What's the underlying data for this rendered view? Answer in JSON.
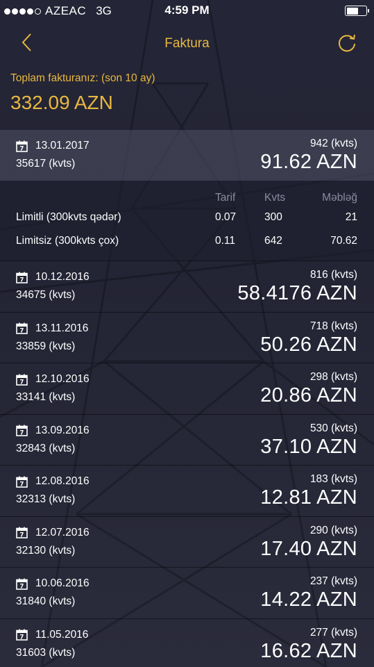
{
  "status_bar": {
    "carrier": "AZEAC",
    "network": "3G",
    "time": "4:59 PM",
    "battery_level": 0.62
  },
  "nav": {
    "title": "Faktura",
    "back_icon": "chevron-left-icon",
    "refresh_icon": "refresh-icon"
  },
  "total": {
    "label": "Toplam fakturanız: (son 10 ay)",
    "value": "332.09 AZN"
  },
  "first_invoice": {
    "date": "13.01.2017",
    "reading": "35617 (kvts)",
    "kvts": "942 (kvts)",
    "amount": "91.62 AZN"
  },
  "detail": {
    "headers": {
      "tarif": "Tarif",
      "kvts": "Kvts",
      "mebleg": "Məbləğ"
    },
    "rows": [
      {
        "name": "Limitli (300kvts qədər)",
        "tarif": "0.07",
        "kvts": "300",
        "mebleg": "21"
      },
      {
        "name": "Limitsiz (300kvts çox)",
        "tarif": "0.11",
        "kvts": "642",
        "mebleg": "70.62"
      }
    ]
  },
  "invoices": [
    {
      "date": "10.12.2016",
      "reading": "34675 (kvts)",
      "kvts": "816 (kvts)",
      "amount": "58.4176 AZN"
    },
    {
      "date": "13.11.2016",
      "reading": "33859 (kvts)",
      "kvts": "718 (kvts)",
      "amount": "50.26 AZN"
    },
    {
      "date": "12.10.2016",
      "reading": "33141 (kvts)",
      "kvts": "298 (kvts)",
      "amount": "20.86 AZN"
    },
    {
      "date": "13.09.2016",
      "reading": "32843 (kvts)",
      "kvts": "530 (kvts)",
      "amount": "37.10 AZN"
    },
    {
      "date": "12.08.2016",
      "reading": "32313 (kvts)",
      "kvts": "183 (kvts)",
      "amount": "12.81 AZN"
    },
    {
      "date": "12.07.2016",
      "reading": "32130 (kvts)",
      "kvts": "290 (kvts)",
      "amount": "17.40 AZN"
    },
    {
      "date": "10.06.2016",
      "reading": "31840 (kvts)",
      "kvts": "237 (kvts)",
      "amount": "14.22 AZN"
    },
    {
      "date": "11.05.2016",
      "reading": "31603 (kvts)",
      "kvts": "277 (kvts)",
      "amount": "16.62 AZN"
    }
  ],
  "calendar_icon_day": "7",
  "colors": {
    "accent": "#e8b840",
    "background": "#242536",
    "header_gray": "#8a8ca0"
  }
}
